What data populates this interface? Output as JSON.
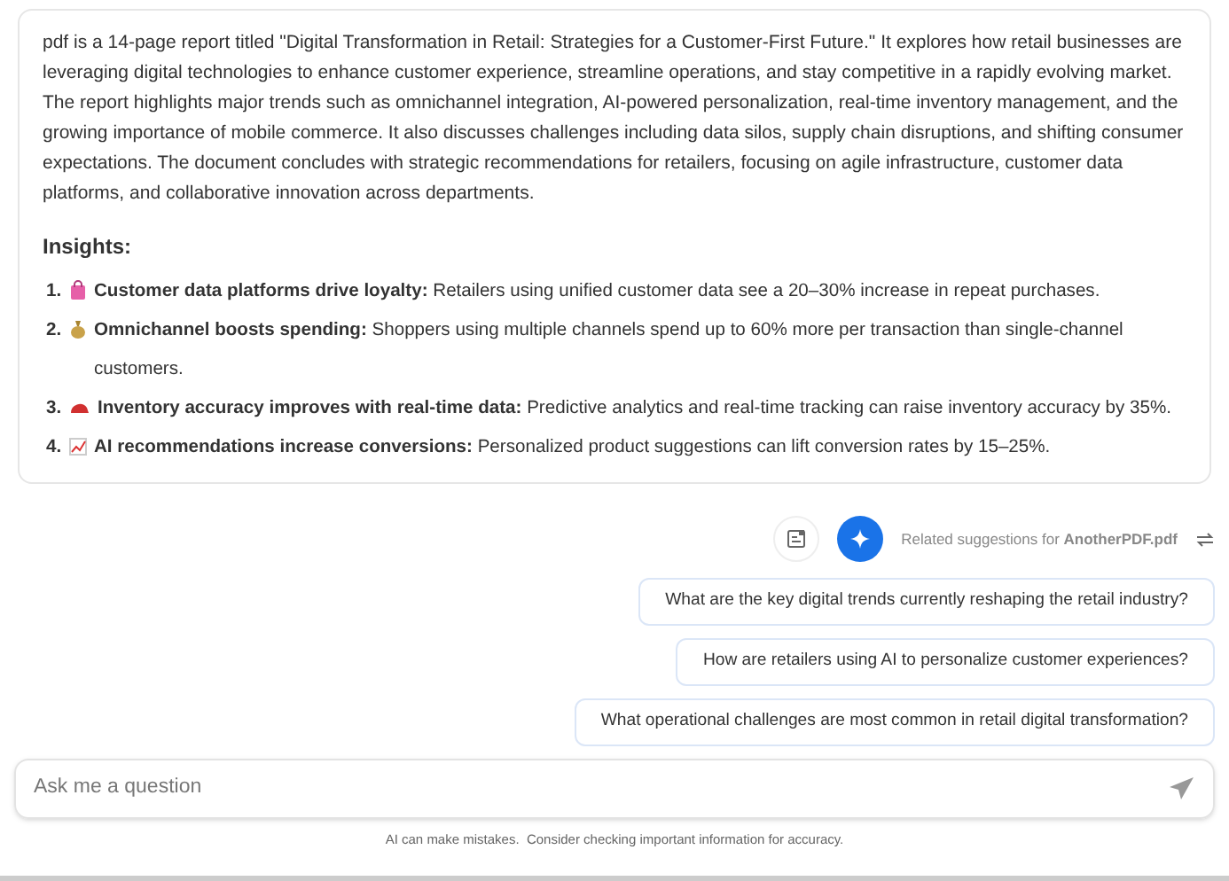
{
  "summary": "pdf is a 14-page report titled \"Digital Transformation in Retail: Strategies for a Customer-First Future.\" It explores how retail businesses are leveraging digital technologies to enhance customer experience, streamline operations, and stay competitive in a rapidly evolving market. The report highlights major trends such as omnichannel integration, AI-powered personalization, real-time inventory management, and the growing importance of mobile commerce. It also discusses challenges including data silos, supply chain disruptions, and shifting consumer expectations. The document concludes with strategic recommendations for retailers, focusing on agile infrastructure, customer data platforms, and collaborative innovation across departments.",
  "insights_heading": "Insights:",
  "insights": [
    {
      "number": "1.",
      "text": "**Customer data platforms drive loyalty:** Retailers using unified customer data see a 20–30% increase in repeat purchases."
    },
    {
      "number": "2.",
      "text": "**Omnichannel boosts spending:** Shoppers using multiple channels spend up to 60% more per transaction than single-channel customers."
    },
    {
      "number": "3.",
      "text": "**Inventory accuracy improves with real-time data:** Predictive analytics and real-time tracking can raise inventory accuracy by 35%."
    },
    {
      "number": "4.",
      "text": "**AI recommendations increase conversions:** Personalized product suggestions can lift conversion rates by 15–25%."
    }
  ],
  "related": "Related suggestions for **AnotherPDF.pdf**",
  "suggestions": [
    "What are the key digital trends currently reshaping the retail industry?",
    "How are retailers using AI to personalize customer experiences?",
    "What operational challenges are most common in retail digital transformation?"
  ],
  "input": {
    "placeholder": "Ask me a question"
  },
  "disclaimer": "AI can make mistakes.  Consider checking important information for accuracy."
}
